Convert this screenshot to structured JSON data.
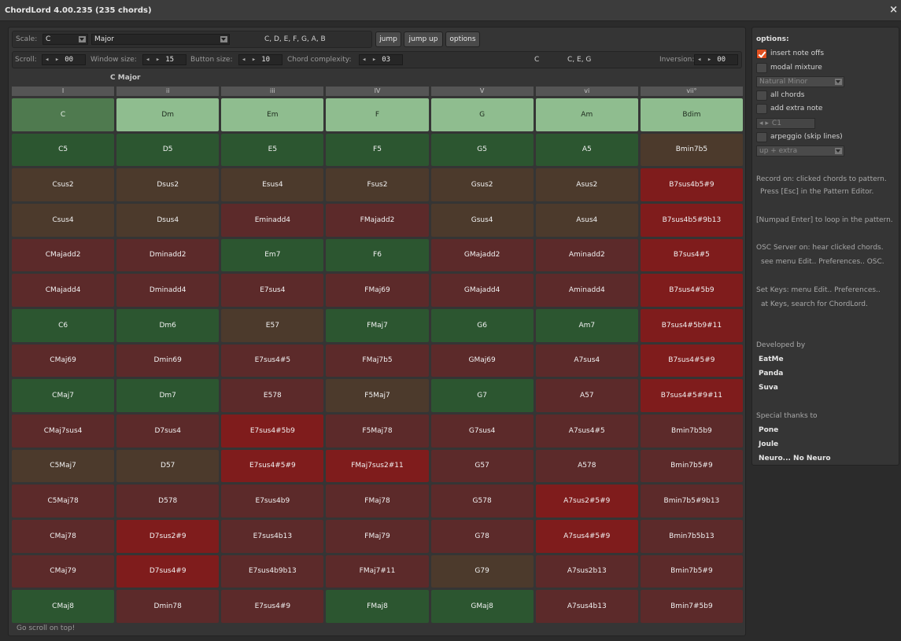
{
  "window": {
    "title": "ChordLord 4.00.235 (235 chords)",
    "close": "×"
  },
  "toolbar": {
    "scale_label": "Scale:",
    "root": "C",
    "mode": "Major",
    "notes": "C, D, E, F, G, A, B",
    "jump": "jump",
    "jump_up": "jump up",
    "options": "options"
  },
  "controls": {
    "scroll_label": "Scroll:",
    "scroll": "00",
    "window_label": "Window size:",
    "window": "15",
    "button_label": "Button size:",
    "button": "10",
    "complexity_label": "Chord complexity:",
    "complexity": "03",
    "chord": "C",
    "chord_notes": "C, E, G",
    "inversion_label": "Inversion:",
    "inversion": "00",
    "arrows": "◂ ▸"
  },
  "scale_name": "C Major",
  "degrees": [
    "I",
    "ii",
    "iii",
    "IV",
    "V",
    "vi",
    "vii°"
  ],
  "chords": [
    [
      "C",
      "Dm",
      "Em",
      "F",
      "G",
      "Am",
      "Bdim"
    ],
    [
      "C5",
      "D5",
      "E5",
      "F5",
      "G5",
      "A5",
      "Bmin7b5"
    ],
    [
      "Csus2",
      "Dsus2",
      "Esus4",
      "Fsus2",
      "Gsus2",
      "Asus2",
      "B7sus4b5#9"
    ],
    [
      "Csus4",
      "Dsus4",
      "Eminadd4",
      "FMajadd2",
      "Gsus4",
      "Asus4",
      "B7sus4b5#9b13"
    ],
    [
      "CMajadd2",
      "Dminadd2",
      "Em7",
      "F6",
      "GMajadd2",
      "Aminadd2",
      "B7sus4#5"
    ],
    [
      "CMajadd4",
      "Dminadd4",
      "E7sus4",
      "FMaj69",
      "GMajadd4",
      "Aminadd4",
      "B7sus4#5b9"
    ],
    [
      "C6",
      "Dm6",
      "E57",
      "FMaj7",
      "G6",
      "Am7",
      "B7sus4#5b9#11"
    ],
    [
      "CMaj69",
      "Dmin69",
      "E7sus4#5",
      "FMaj7b5",
      "GMaj69",
      "A7sus4",
      "B7sus4#5#9"
    ],
    [
      "CMaj7",
      "Dm7",
      "E578",
      "F5Maj7",
      "G7",
      "A57",
      "B7sus4#5#9#11"
    ],
    [
      "CMaj7sus4",
      "D7sus4",
      "E7sus4#5b9",
      "F5Maj78",
      "G7sus4",
      "A7sus4#5",
      "Bmin7b5b9"
    ],
    [
      "C5Maj7",
      "D57",
      "E7sus4#5#9",
      "FMaj7sus2#11",
      "G57",
      "A578",
      "Bmin7b5#9"
    ],
    [
      "C5Maj78",
      "D578",
      "E7sus4b9",
      "FMaj78",
      "G578",
      "A7sus2#5#9",
      "Bmin7b5#9b13"
    ],
    [
      "CMaj78",
      "D7sus2#9",
      "E7sus4b13",
      "FMaj79",
      "G78",
      "A7sus4#5#9",
      "Bmin7b5b13"
    ],
    [
      "CMaj79",
      "D7sus4#9",
      "E7sus4b9b13",
      "FMaj7#11",
      "G79",
      "A7sus2b13",
      "Bmin7b5#9"
    ],
    [
      "CMaj8",
      "Dmin78",
      "E7sus4#9",
      "FMaj8",
      "GMaj8",
      "A7sus4b13",
      "Bmin7#5b9"
    ]
  ],
  "chord_colors": [
    [
      "sel",
      "light",
      "light",
      "light",
      "light",
      "light",
      "light"
    ],
    [
      "green",
      "green",
      "green",
      "green",
      "green",
      "green",
      "brown"
    ],
    [
      "brown",
      "brown",
      "brown",
      "brown",
      "brown",
      "brown",
      "red"
    ],
    [
      "brown",
      "brown",
      "dred",
      "dred",
      "brown",
      "brown",
      "red"
    ],
    [
      "dred",
      "dred",
      "green",
      "green",
      "dred",
      "dred",
      "red"
    ],
    [
      "dred",
      "dred",
      "dred",
      "dred",
      "dred",
      "dred",
      "red"
    ],
    [
      "green",
      "green",
      "brown",
      "green",
      "green",
      "green",
      "red"
    ],
    [
      "dred",
      "dred",
      "dred",
      "dred",
      "dred",
      "dred",
      "red"
    ],
    [
      "green",
      "green",
      "dred",
      "brown",
      "green",
      "dred",
      "red"
    ],
    [
      "dred",
      "dred",
      "red",
      "dred",
      "dred",
      "dred",
      "dred"
    ],
    [
      "brown",
      "brown",
      "red",
      "red",
      "dred",
      "dred",
      "dred"
    ],
    [
      "dred",
      "dred",
      "dred",
      "dred",
      "dred",
      "red",
      "dred"
    ],
    [
      "dred",
      "red",
      "dred",
      "dred",
      "dred",
      "red",
      "dred"
    ],
    [
      "dred",
      "red",
      "dred",
      "dred",
      "brown",
      "dred",
      "dred"
    ],
    [
      "green",
      "dred",
      "dred",
      "green",
      "green",
      "dred",
      "dred"
    ]
  ],
  "footer": "Go scroll on top!",
  "options_panel": {
    "title": "options:",
    "insert_note_offs": "insert note offs",
    "modal_mixture": "modal mixture",
    "mixture_mode": "Natural Minor",
    "all_chords": "all chords",
    "add_extra_note": "add extra note",
    "extra_note": "C1",
    "arpeggio": "arpeggio (skip lines)",
    "arp_mode": "up + extra",
    "info1a": "Record on: clicked chords to pattern.",
    "info1b": "Press [Esc] in the Pattern Editor.",
    "info2": "[Numpad Enter] to loop in the pattern.",
    "info3a": "OSC Server on: hear clicked chords.",
    "info3b": "see menu Edit.. Preferences.. OSC.",
    "info4a": "Set Keys: menu Edit.. Preferences..",
    "info4b": "at Keys, search for ChordLord.",
    "dev_title": "Developed by",
    "dev1": "EatMe",
    "dev2": "Panda",
    "dev3": "Suva",
    "thanks_title": "Special thanks to",
    "th1": "Pone",
    "th2": "Joule",
    "th3": "Neuro... No Neuro"
  },
  "colors": {
    "green": "#2c5630",
    "brown": "#4c3a2c",
    "dred": "#5c2a2a",
    "red": "#7f1c1c",
    "light": "#8fbd8f",
    "sel": "#4f7a4f",
    "accent": "#e05020"
  }
}
